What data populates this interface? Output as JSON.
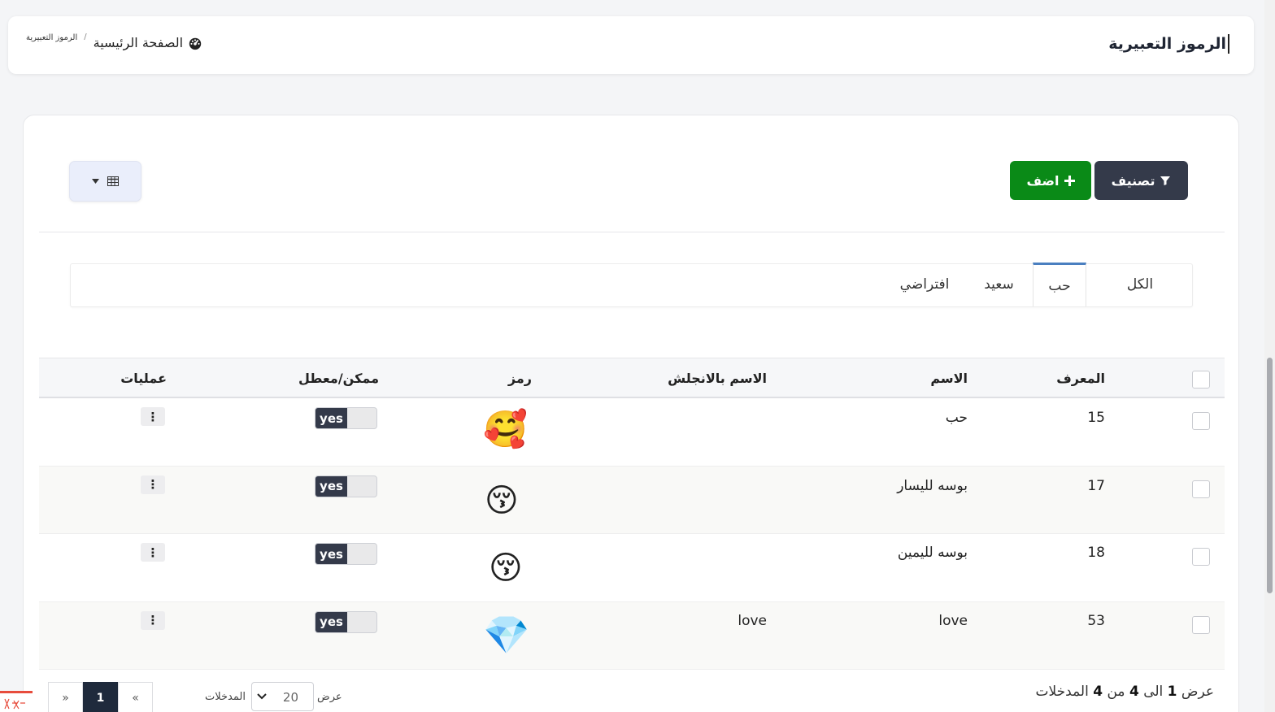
{
  "header": {
    "title": "الرموز التعبيرية",
    "breadcrumb": {
      "home": "الصفحة الرئيسية",
      "separator": "/",
      "current": "الرموز التعبيرية"
    }
  },
  "toolbar": {
    "filter_label": "تصنيف",
    "add_label": "اضف",
    "view_icon": "table-icon"
  },
  "tabs": [
    {
      "label": "الكل",
      "active": false
    },
    {
      "label": "حب",
      "active": true
    },
    {
      "label": "سعيد",
      "active": false
    },
    {
      "label": "افتراضي",
      "active": false
    }
  ],
  "table": {
    "columns": {
      "id": "المعرف",
      "name": "الاسم",
      "name_en": "الاسم بالانجلش",
      "symbol": "رمز",
      "enabled": "ممكن/معطل",
      "actions": "عمليات"
    },
    "rows": [
      {
        "id": "15",
        "name": "حب",
        "name_en": "",
        "emoji": "🥰",
        "enabled": "yes",
        "actions": "⋮"
      },
      {
        "id": "17",
        "name": "بوسه لليسار",
        "name_en": "",
        "emoji": "😚",
        "enabled": "yes",
        "actions": "⋮"
      },
      {
        "id": "18",
        "name": "بوسه لليمين",
        "name_en": "",
        "emoji": "😚",
        "enabled": "yes",
        "actions": "⋮"
      },
      {
        "id": "53",
        "name": "love",
        "name_en": "love",
        "emoji": "💎",
        "enabled": "yes",
        "actions": "⋮"
      }
    ]
  },
  "footer": {
    "info_prefix": "عرض",
    "info_from": "1",
    "info_to_word": "الى",
    "info_to": "4",
    "info_of_word": "من",
    "info_total": "4",
    "info_suffix": "المدخلات",
    "length_show": "عرض",
    "length_value": "20",
    "length_entries": "المدخلات",
    "pager_prev": "«",
    "pager_current": "1",
    "pager_next": "»"
  }
}
